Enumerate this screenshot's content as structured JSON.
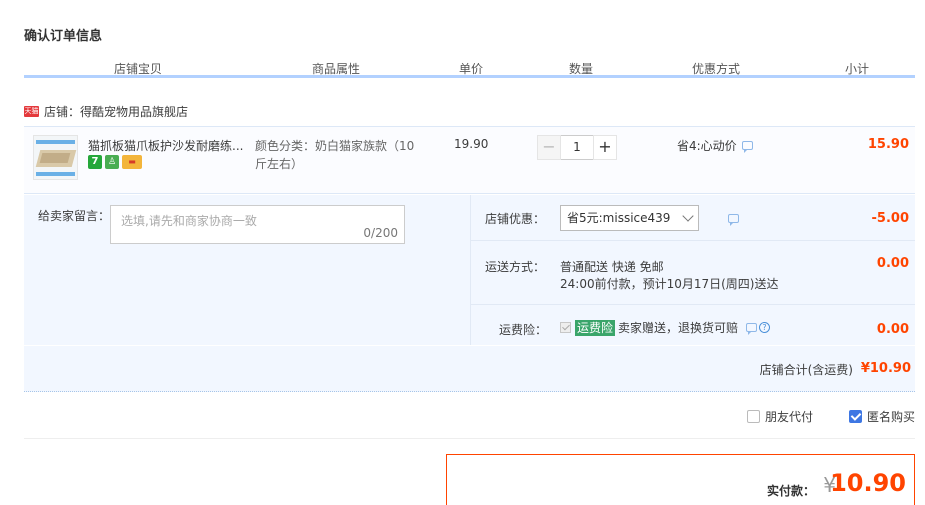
{
  "title": "确认订单信息",
  "columns": [
    "店铺宝贝",
    "商品属性",
    "单价",
    "数量",
    "优惠方式",
    "小计"
  ],
  "shop": {
    "badge": "天猫",
    "name": "店铺：得酷宠物用品旗舰店"
  },
  "item": {
    "title": "猫抓板猫爪板护沙发耐磨练...",
    "tags": [
      "7",
      "♙",
      "▬"
    ],
    "attr": "颜色分类：奶白猫家族款（10斤左右）",
    "price": "19.90",
    "quantity": "1",
    "promo": "省4:心动价",
    "subtotal": "15.90"
  },
  "message": {
    "label": "给卖家留言：",
    "placeholder": "选填,请先和商家协商一致",
    "counter": "0/200"
  },
  "discount": {
    "label": "店铺优惠：",
    "selected": "省5元:missice439",
    "amount": "-5.00"
  },
  "shipping": {
    "label": "运送方式：",
    "line1": "普通配送 快递 免邮",
    "line2": "24:00前付款，预计10月17日(周四)送达",
    "amount": "0.00"
  },
  "insurance": {
    "label": "运费险：",
    "badge": "运费险",
    "text": "卖家赠送，退换货可赔",
    "amount": "0.00"
  },
  "shop_total": {
    "label": "店铺合计(含运费)",
    "value": "¥10.90"
  },
  "options": {
    "friend_pay": "朋友代付",
    "anonymous": "匿名购买"
  },
  "pay": {
    "label": "实付款：",
    "currency": "¥",
    "amount": "10.90"
  },
  "colors": {
    "accent": "#ff4400",
    "header_rule": "#b2d1ff",
    "panel_bg": "#f2f7ff",
    "checkbox_on": "#3e77e3"
  }
}
